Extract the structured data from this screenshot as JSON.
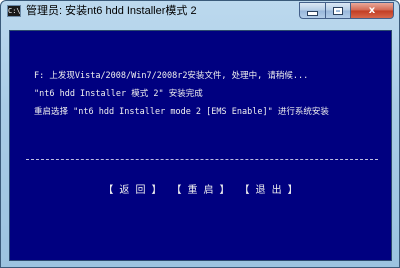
{
  "window": {
    "icon_text": "C:\\",
    "title": "管理员:  安装nt6 hdd Installer模式 2"
  },
  "caption": {
    "close_label": "x"
  },
  "console": {
    "lines": [
      "F: 上发现Vista/2008/Win7/2008r2安装文件, 处理中, 请稍候...",
      "\"nt6 hdd Installer 模式 2\" 安装完成",
      "重启选择 \"nt6 hdd Installer mode 2 [EMS Enable]\" 进行系统安装"
    ],
    "menu": {
      "back": "【 返 回 】",
      "reboot": "【 重 启 】",
      "exit": "【 退 出 】"
    }
  },
  "colors": {
    "console_background": "#000080",
    "console_text": "#f0f0f0"
  }
}
